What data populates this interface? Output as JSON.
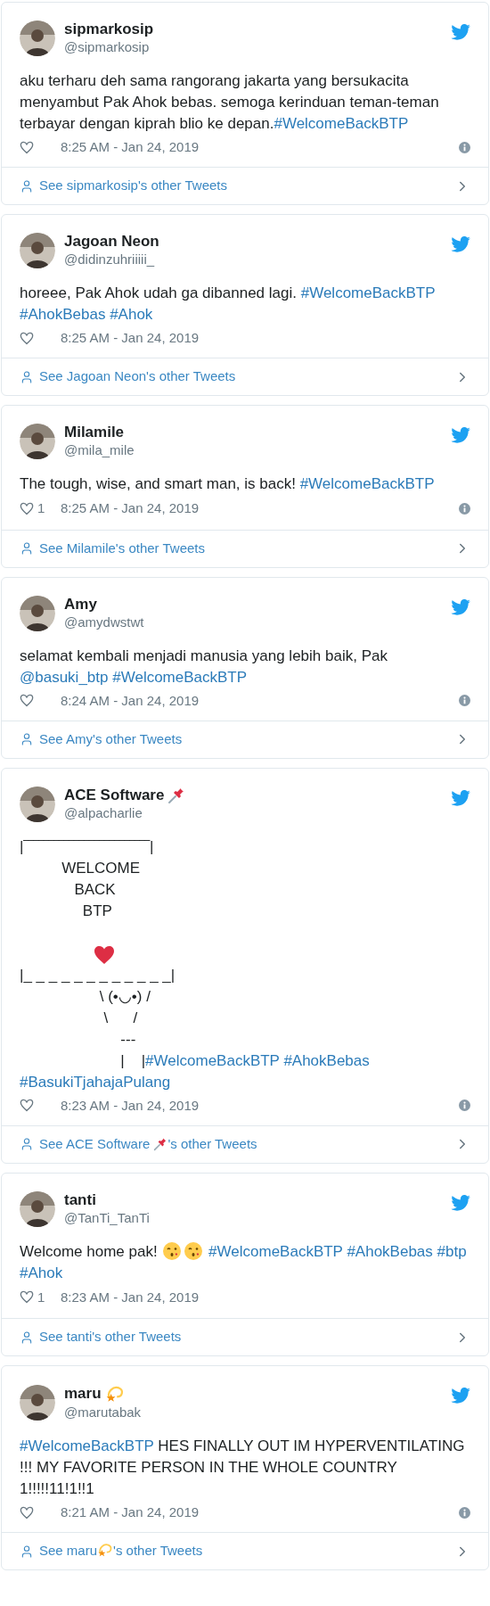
{
  "tweets": [
    {
      "name": "sipmarkosip",
      "handle": "@sipmarkosip",
      "info_icon": true,
      "time": "8:25 AM - Jan 24, 2019",
      "body": [
        [
          {
            "kind": "text",
            "text": "aku terharu deh sama rangorang jakarta yang bersukacita menyambut Pak Ahok bebas. semoga kerinduan teman-teman terbayar dengan kiprah blio ke depan."
          },
          {
            "kind": "hashtag",
            "text": "#WelcomeBackBTP"
          }
        ]
      ],
      "footer": [
        {
          "kind": "text",
          "text": "See sipmarkosip's other Tweets"
        }
      ]
    },
    {
      "name": "Jagoan Neon",
      "handle": "@didinzuhriiiii_",
      "info_icon": false,
      "time": "8:25 AM - Jan 24, 2019",
      "body": [
        [
          {
            "kind": "text",
            "text": "horeee, Pak Ahok udah ga dibanned lagi. "
          },
          {
            "kind": "hashtag",
            "text": "#WelcomeBackBTP"
          },
          {
            "kind": "hashtag",
            "text": "#AhokBebas",
            "space_before": true
          },
          {
            "kind": "hashtag",
            "text": "#Ahok",
            "space_before": true
          }
        ]
      ],
      "footer": [
        {
          "kind": "text",
          "text": "See Jagoan Neon's other Tweets"
        }
      ]
    },
    {
      "name": "Milamile",
      "handle": "@mila_mile",
      "info_icon": true,
      "likes": "1",
      "time": "8:25 AM - Jan 24, 2019",
      "body": [
        [
          {
            "kind": "text",
            "text": "The tough, wise, and smart man, is back! "
          },
          {
            "kind": "hashtag",
            "text": "#WelcomeBackBTP"
          }
        ]
      ],
      "footer": [
        {
          "kind": "text",
          "text": "See Milamile's other Tweets"
        }
      ]
    },
    {
      "name": "Amy",
      "handle": "@amydwstwt",
      "info_icon": true,
      "time": "8:24 AM - Jan 24, 2019",
      "body": [
        [
          {
            "kind": "text",
            "text": "selamat kembali menjadi manusia yang lebih baik, Pak "
          },
          {
            "kind": "mention",
            "text": "@basuki_btp"
          },
          {
            "kind": "hashtag",
            "text": "#WelcomeBackBTP",
            "space_before": true
          }
        ]
      ],
      "footer": [
        {
          "kind": "text",
          "text": "See Amy's other Tweets"
        }
      ]
    },
    {
      "name": "ACE Software",
      "name_emoji": {
        "kind": "pin-emoji"
      },
      "handle": "@alpacharlie",
      "info_icon": true,
      "time": "8:23 AM - Jan 24, 2019",
      "body": [
        [
          {
            "kind": "text",
            "text": "|‾‾‾‾‾‾‾‾‾‾‾‾‾‾‾‾‾‾‾‾‾‾‾‾‾|"
          }
        ],
        [
          {
            "kind": "text",
            "text": "          WELCOME"
          }
        ],
        [
          {
            "kind": "text",
            "text": "             BACK"
          }
        ],
        [
          {
            "kind": "text",
            "text": "               BTP"
          }
        ],
        [
          {
            "kind": "heart-emoji"
          }
        ],
        [
          {
            "kind": "text",
            "text": "|_ _ _ _ _ _ _ _ _ _ _ _|"
          }
        ],
        [
          {
            "kind": "text",
            "text": "                   \\ (•◡•) /"
          }
        ],
        [
          {
            "kind": "text",
            "text": "                    \\      /"
          }
        ],
        [
          {
            "kind": "text",
            "text": "                        ---"
          }
        ],
        [
          {
            "kind": "text",
            "text": "                        |    |"
          },
          {
            "kind": "hashtag",
            "text": "#WelcomeBackBTP"
          },
          {
            "kind": "hashtag",
            "text": "#AhokBebas",
            "space_before": true
          },
          {
            "kind": "hashtag",
            "text": "#BasukiTjahajaPulang",
            "space_before": true
          }
        ]
      ],
      "footer": [
        {
          "kind": "text",
          "text": "See ACE Software "
        },
        {
          "kind": "pin-emoji"
        },
        {
          "kind": "text",
          "text": "'s other Tweets"
        }
      ]
    },
    {
      "name": "tanti",
      "handle": "@TanTi_TanTi",
      "info_icon": false,
      "likes": "1",
      "time": "8:23 AM - Jan 24, 2019",
      "body": [
        [
          {
            "kind": "text",
            "text": "Welcome home pak! "
          },
          {
            "kind": "kiss-emoji"
          },
          {
            "kind": "kiss-emoji"
          },
          {
            "kind": "hashtag",
            "text": "#WelcomeBackBTP",
            "space_before": true
          },
          {
            "kind": "hashtag",
            "text": "#AhokBebas",
            "space_before": true
          },
          {
            "kind": "hashtag",
            "text": "#btp",
            "space_before": true
          },
          {
            "kind": "hashtag",
            "text": "#Ahok",
            "space_before": true
          }
        ]
      ],
      "footer": [
        {
          "kind": "text",
          "text": "See tanti's other Tweets"
        }
      ]
    },
    {
      "name": "maru",
      "name_emoji": {
        "kind": "dizzy-emoji"
      },
      "handle": "@marutabak",
      "info_icon": true,
      "time": "8:21 AM - Jan 24, 2019",
      "body": [
        [
          {
            "kind": "hashtag",
            "text": "#WelcomeBackBTP"
          },
          {
            "kind": "text",
            "text": " HES FINALLY OUT IM HYPERVENTILATING !!! MY FAVORITE PERSON IN THE WHOLE COUNTRY 1!!!!!11!1!!1"
          }
        ]
      ],
      "footer": [
        {
          "kind": "text",
          "text": "See maru"
        },
        {
          "kind": "dizzy-emoji"
        },
        {
          "kind": "text",
          "text": "'s other Tweets"
        }
      ]
    }
  ]
}
